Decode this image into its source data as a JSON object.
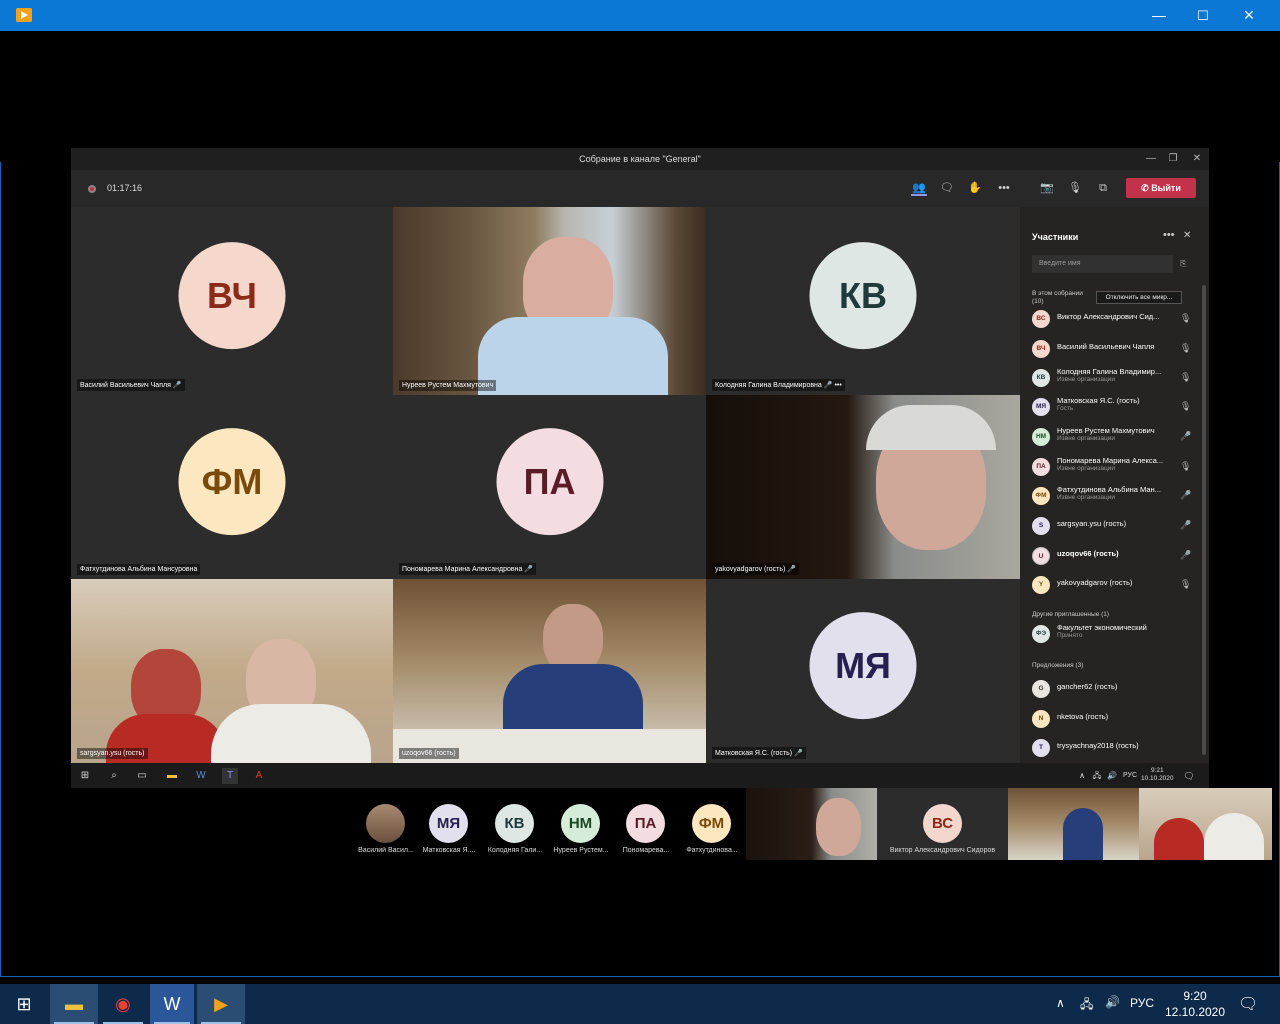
{
  "outer_window": {
    "title": "",
    "controls": [
      "—",
      "☐",
      "✕"
    ]
  },
  "teams": {
    "title": "Собрание в канале \"General\"",
    "timer": "01:17:16",
    "leave_label": "Выйти",
    "icons": [
      "participants-icon",
      "chat-icon",
      "raise-hand-icon",
      "more-icon",
      "camera-off-icon",
      "mic-off-icon",
      "share-icon",
      "phone-icon"
    ]
  },
  "tiles": [
    {
      "name": "Василий Васильевич Чапля",
      "initials": "ВЧ",
      "bg": "#f6d7cc",
      "fg": "#8a2a17",
      "mic": "🎤̸"
    },
    {
      "name": "Нуреев Рустем Махмутович",
      "video": true
    },
    {
      "name": "Колодняя Галина Владимировна",
      "initials": "КВ",
      "bg": "#dfe7e4",
      "fg": "#1e3a3a",
      "mic": "🎤̸",
      "more": "•••"
    },
    {
      "name": "Фатхутдинова Альбина Мансуровна",
      "initials": "ФМ",
      "bg": "#fde7c0",
      "fg": "#7a4a0a"
    },
    {
      "name": "Пономарева Марина Александровна",
      "initials": "ПА",
      "bg": "#f4dde0",
      "fg": "#5a1d28",
      "mic": "🎤̸"
    },
    {
      "name": "yakovyadgarov (гость)",
      "video": true,
      "mic": "🎤̸"
    },
    {
      "name": "sargsyan.ysu (гость)",
      "video": true
    },
    {
      "name": "uzoqov66 (гость)",
      "video": true
    },
    {
      "name": "Матковская Я.С. (гость)",
      "initials": "МЯ",
      "bg": "#e3e0ee",
      "fg": "#262050",
      "mic": "🎤̸"
    }
  ],
  "panel": {
    "title": "Участники",
    "more": "•••",
    "close": "✕",
    "search_placeholder": "Введите имя",
    "section_in_meeting": "В этом собрании (10)",
    "mute_all": "Отключить все микр...",
    "participants": [
      {
        "initials": "ВС",
        "name": "Виктор Александрович Сид...",
        "sub": "",
        "bg": "#f3d7cf",
        "fg": "#8a2a17"
      },
      {
        "initials": "ВЧ",
        "name": "Василий Васильевич Чапля",
        "sub": "",
        "bg": "#f6d7cc",
        "fg": "#8a2a17"
      },
      {
        "initials": "КВ",
        "name": "Колодняя Галина Владимир...",
        "sub": "Извне организации",
        "bg": "#dfe7e4",
        "fg": "#1e3a3a"
      },
      {
        "initials": "МЯ",
        "name": "Матковская Я.С. (гость)",
        "sub": "Гость",
        "bg": "#e3e0ee",
        "fg": "#262050"
      },
      {
        "initials": "НМ",
        "name": "Нуреев Рустем Махмутович",
        "sub": "Извне организации",
        "bg": "#d5ecd8",
        "fg": "#1a4a22"
      },
      {
        "initials": "ПА",
        "name": "Пономарева Марина Алекса...",
        "sub": "Извне организации",
        "bg": "#f4dde0",
        "fg": "#5a1d28"
      },
      {
        "initials": "ФМ",
        "name": "Фатхутдинова Альбина Ман...",
        "sub": "Извне организации",
        "bg": "#fde7c0",
        "fg": "#7a4a0a"
      },
      {
        "initials": "S",
        "name": "sargsyan.ysu (гость)",
        "sub": "",
        "bg": "#e3e0ee",
        "fg": "#262050"
      },
      {
        "initials": "U",
        "name": "uzoqov66 (гость)",
        "sub": "",
        "bg": "#f4dde0",
        "fg": "#5a1d28"
      },
      {
        "initials": "Y",
        "name": "yakovyadgarov (гость)",
        "sub": "",
        "bg": "#fde7c0",
        "fg": "#7a4a0a"
      }
    ],
    "section_invited": "Другие приглашенные (1)",
    "invited": [
      {
        "initials": "ФЭ",
        "name": "Факультет экономический",
        "sub": "Принято",
        "bg": "#dfe7e4",
        "fg": "#1e3a3a"
      }
    ],
    "section_suggestions": "Предложения (3)",
    "suggestions": [
      {
        "initials": "G",
        "name": "gancher62 (гость)",
        "bg": "#e9e6e0",
        "fg": "#333"
      },
      {
        "initials": "N",
        "name": "nketova (гость)",
        "bg": "#fde7c0",
        "fg": "#7a4a0a"
      },
      {
        "initials": "T",
        "name": "trysyachnay2018 (гость)",
        "bg": "#e3e0ee",
        "fg": "#262050"
      }
    ]
  },
  "inner_taskbar": {
    "lang": "РУС",
    "time": "9:21",
    "date": "10.10.2020"
  },
  "strip": [
    {
      "label": "Василий Васил...",
      "photo": true
    },
    {
      "label": "Матковская Я....",
      "initials": "МЯ",
      "bg": "#e3e0ee",
      "fg": "#262050"
    },
    {
      "label": "Колодняя Гали...",
      "initials": "КВ",
      "bg": "#dfe7e4",
      "fg": "#1e3a3a"
    },
    {
      "label": "Нуреев Рустем...",
      "initials": "НМ",
      "bg": "#d5ecd8",
      "fg": "#1a4a22"
    },
    {
      "label": "Пономарева...",
      "initials": "ПА",
      "bg": "#f4dde0",
      "fg": "#5a1d28"
    },
    {
      "label": "Фатхутдинова...",
      "initials": "ФМ",
      "bg": "#fde7c0",
      "fg": "#7a4a0a"
    }
  ],
  "strip_named": {
    "label": "Виктор Александрович Сидоров",
    "initials": "ВС"
  },
  "taskbar": {
    "lang": "РУС",
    "time": "9:20",
    "date": "12.10.2020"
  }
}
